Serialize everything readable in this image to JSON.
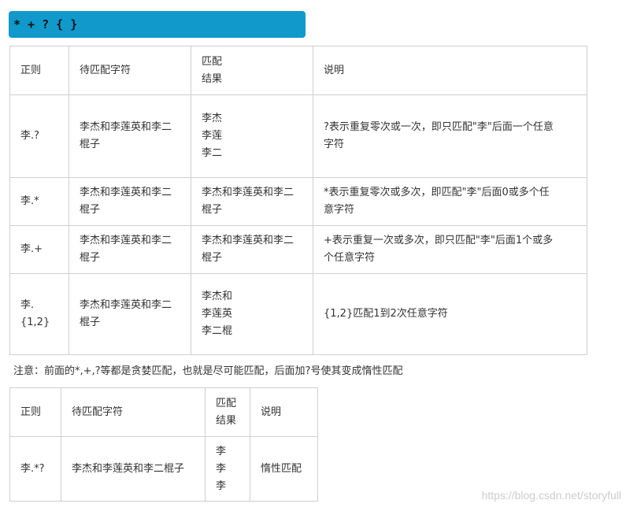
{
  "title": "* + ? { }",
  "table1": {
    "headers": [
      "正则",
      "待匹配字符",
      "匹配\n结果",
      "说明"
    ],
    "rows": [
      [
        "李.?",
        "李杰和李莲英和李二\n棍子",
        "李杰\n李莲\n李二",
        "?表示重复零次或一次，即只匹配\"李\"后面一个任意\n字符"
      ],
      [
        "李.*",
        "李杰和李莲英和李二\n棍子",
        "李杰和李莲英和李二\n棍子",
        "*表示重复零次或多次，即匹配\"李\"后面0或多个任\n意字符"
      ],
      [
        "李.+",
        "李杰和李莲英和李二\n棍子",
        "李杰和李莲英和李二\n棍子",
        "+表示重复一次或多次，即只匹配\"李\"后面1个或多\n个任意字符"
      ],
      [
        "李.\n{1,2}",
        "李杰和李莲英和李二\n棍子",
        "李杰和\n李莲英\n李二棍",
        "{1,2}匹配1到2次任意字符"
      ]
    ]
  },
  "note": "注意：前面的*,+,?等都是贪婪匹配，也就是尽可能匹配，后面加?号使其变成惰性匹配",
  "table2": {
    "headers": [
      "正则",
      "待匹配字符",
      "匹配\n结果",
      "说明"
    ],
    "rows": [
      [
        "李.*?",
        "李杰和李莲英和李二棍子",
        "李\n李\n李",
        "惰性匹配"
      ]
    ]
  },
  "watermark": "https://blog.csdn.net/storyfull",
  "colors": {
    "title_bar": "#1199cc",
    "border": "#cfcfcf",
    "text": "#333333"
  }
}
